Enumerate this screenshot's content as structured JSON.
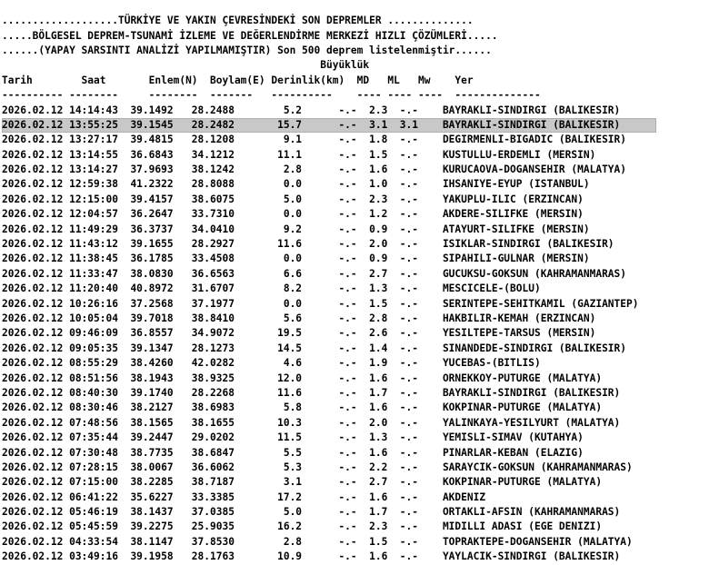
{
  "header": {
    "line1": "...................TÜRKİYE VE YAKIN ÇEVRESİNDEKİ SON DEPREMLER ..............",
    "line2": ".....BÖLGESEL DEPREM-TSUNAMİ İZLEME VE DEĞERLENDİRME MERKEZİ HIZLI ÇÖZÜMLERİ.....",
    "line3": "......(YAPAY SARSINTI ANALİZİ YAPILMAMIŞTIR) Son 500 deprem listelenmiştir......"
  },
  "columns": {
    "magnitude_group_line": "                                                    Büyüklük",
    "header_line": "Tarih        Saat       Enlem(N)  Boylam(E) Derinlik(km)  MD   ML   Mw    Yer",
    "separator_line": "---------- --------     --------  -------   ----------    ---- ---- ----  --------------"
  },
  "rows": [
    "2026.02.12 14:14:43  39.1492   28.2488        5.2      -.-  2.3  -.-    BAYRAKLI-SINDIRGI (BALIKESIR)",
    "2026.02.12 13:55:25  39.1545   28.2482       15.7      -.-  3.1  3.1    BAYRAKLI-SINDIRGI (BALIKESIR)",
    "2026.02.12 13:27:17  39.4815   28.1208        9.1      -.-  1.8  -.-    DEGIRMENLI-BIGADIC (BALIKESIR)",
    "2026.02.12 13:14:55  36.6843   34.1212       11.1      -.-  1.5  -.-    KUSTULLU-ERDEMLI (MERSIN)",
    "2026.02.12 13:14:27  37.9693   38.1242        2.8      -.-  1.6  -.-    KURUCAOVA-DOGANSEHIR (MALATYA)",
    "2026.02.12 12:59:38  41.2322   28.8088        0.0      -.-  1.0  -.-    IHSANIYE-EYUP (ISTANBUL)",
    "2026.02.12 12:15:00  39.4157   38.6075        5.0      -.-  2.3  -.-    YAKUPLU-ILIC (ERZINCAN)",
    "2026.02.12 12:04:57  36.2647   33.7310        0.0      -.-  1.2  -.-    AKDERE-SILIFKE (MERSIN)",
    "2026.02.12 11:49:29  36.3737   34.0410        9.2      -.-  0.9  -.-    ATAYURT-SILIFKE (MERSIN)",
    "2026.02.12 11:43:12  39.1655   28.2927       11.6      -.-  2.0  -.-    ISIKLAR-SINDIRGI (BALIKESIR)",
    "2026.02.12 11:38:45  36.1785   33.4508        0.0      -.-  0.9  -.-    SIPAHILI-GULNAR (MERSIN)",
    "2026.02.12 11:33:47  38.0830   36.6563        6.6      -.-  2.7  -.-    GUCUKSU-GOKSUN (KAHRAMANMARAS)",
    "2026.02.12 11:20:40  40.8972   31.6707        8.2      -.-  1.3  -.-    MESCICELE-(BOLU)",
    "2026.02.12 10:26:16  37.2568   37.1977        0.0      -.-  1.5  -.-    SERINTEPE-SEHITKAMIL (GAZIANTEP)",
    "2026.02.12 10:05:04  39.7018   38.8410        5.6      -.-  2.8  -.-    HAKBILIR-KEMAH (ERZINCAN)",
    "2026.02.12 09:46:09  36.8557   34.9072       19.5      -.-  2.6  -.-    YESILTEPE-TARSUS (MERSIN)",
    "2026.02.12 09:05:35  39.1347   28.1273       14.5      -.-  1.4  -.-    SINANDEDE-SINDIRGI (BALIKESIR)",
    "2026.02.12 08:55:29  38.4260   42.0282        4.6      -.-  1.9  -.-    YUCEBAS-(BITLIS)",
    "2026.02.12 08:51:56  38.1943   38.9325       12.0      -.-  1.6  -.-    ORNEKKOY-PUTURGE (MALATYA)",
    "2026.02.12 08:40:30  39.1740   28.2268       11.6      -.-  1.7  -.-    BAYRAKLI-SINDIRGI (BALIKESIR)",
    "2026.02.12 08:30:46  38.2127   38.6983        5.8      -.-  1.6  -.-    KOKPINAR-PUTURGE (MALATYA)",
    "2026.02.12 07:48:56  38.1565   38.1655       10.3      -.-  2.0  -.-    YALINKAYA-YESILYURT (MALATYA)",
    "2026.02.12 07:35:44  39.2447   29.0202       11.5      -.-  1.3  -.-    YEMISLI-SIMAV (KUTAHYA)",
    "2026.02.12 07:30:48  38.7735   38.6847        5.5      -.-  1.6  -.-    PINARLAR-KEBAN (ELAZIG)",
    "2026.02.12 07:28:15  38.0067   36.6062        5.3      -.-  2.2  -.-    SARAYCIK-GOKSUN (KAHRAMANMARAS)",
    "2026.02.12 07:15:00  38.2285   38.7187        3.1      -.-  2.7  -.-    KOKPINAR-PUTURGE (MALATYA)",
    "2026.02.12 06:41:22  35.6227   33.3385       17.2      -.-  1.6  -.-    AKDENIZ",
    "2026.02.12 05:46:19  38.1437   37.0385        5.0      -.-  1.7  -.-    ORTAKLI-AFSIN (KAHRAMANMARAS)",
    "2026.02.12 05:45:59  39.2275   25.9035       16.2      -.-  2.3  -.-    MIDILLI ADASI (EGE DENIZI)",
    "2026.02.12 04:33:54  38.1147   37.8530        2.8      -.-  1.5  -.-    TOPRAKTEPE-DOGANSEHIR (MALATYA)",
    "2026.02.12 03:49:16  39.1958   28.1763       10.9      -.-  1.6  -.-    YAYLACIK-SINDIRGI (BALIKESIR)"
  ],
  "selected_row_index": 1,
  "colors": {
    "text": "#000000",
    "background": "#ffffff",
    "selection": "#c8c8c8"
  }
}
